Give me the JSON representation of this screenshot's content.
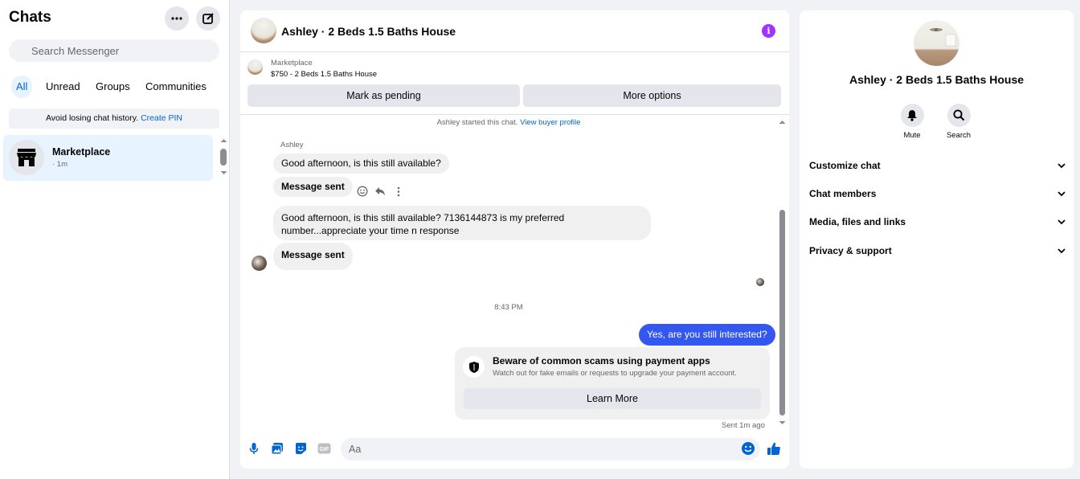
{
  "sidebar": {
    "title": "Chats",
    "search_placeholder": "Search Messenger",
    "filters": [
      "All",
      "Unread",
      "Groups",
      "Communities"
    ],
    "pin_banner": {
      "text": "Avoid losing chat history.",
      "link": "Create PIN"
    },
    "chats": [
      {
        "name": "Marketplace",
        "meta": "· 1m"
      }
    ]
  },
  "conversation": {
    "title": "Ashley · 2 Beds 1.5 Baths House",
    "marketplace": {
      "label": "Marketplace",
      "listing": "$750 - 2 Beds 1.5 Baths House",
      "mark_pending": "Mark as pending",
      "more_options": "More options"
    },
    "started_note": {
      "text": "Ashley started this chat.",
      "link": "View buyer profile"
    },
    "sender_name": "Ashley",
    "messages": [
      {
        "text": "Good afternoon, is this still available?"
      },
      {
        "text": "Message sent"
      },
      {
        "text": "Good afternoon, is this still available? 7136144873 is my preferred number...appreciate your time n response"
      },
      {
        "text": "Message sent"
      }
    ],
    "time_divider": "8:43 PM",
    "outgoing": "Yes, are you still interested?",
    "scam_card": {
      "heading": "Beware of common scams using payment apps",
      "body": "Watch out for fake emails or requests to upgrade your payment account.",
      "button": "Learn More"
    },
    "sent_status": "Sent 1m ago",
    "composer_placeholder": "Aa",
    "colors": {
      "outgoing_bubble": "#3458ef",
      "accent": "#0064d1",
      "info": "#a033ff"
    }
  },
  "details": {
    "name": "Ashley · 2 Beds 1.5 Baths House",
    "actions": [
      "Mute",
      "Search"
    ],
    "sections": [
      "Customize chat",
      "Chat members",
      "Media, files and links",
      "Privacy & support"
    ]
  }
}
